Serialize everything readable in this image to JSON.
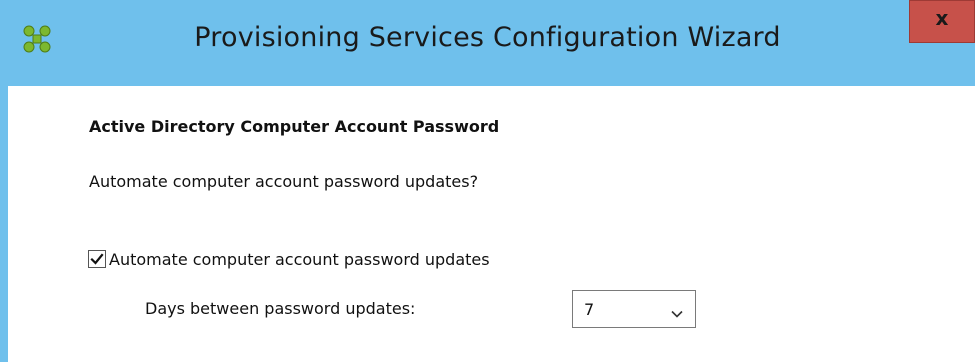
{
  "window": {
    "title": "Provisioning Services Configuration Wizard",
    "close_label": "x",
    "titlebar_color": "#6fc0ec",
    "close_color": "#c7514a",
    "app_icon": "citrix-provisioning-icon"
  },
  "page": {
    "section_title": "Active Directory Computer Account Password",
    "question": "Automate computer account password updates?",
    "automate_checkbox": {
      "label": "Automate computer account password updates",
      "checked": true
    },
    "days_label": "Days between password updates:",
    "days_select": {
      "value": "7",
      "icon": "chevron-down-icon"
    }
  }
}
